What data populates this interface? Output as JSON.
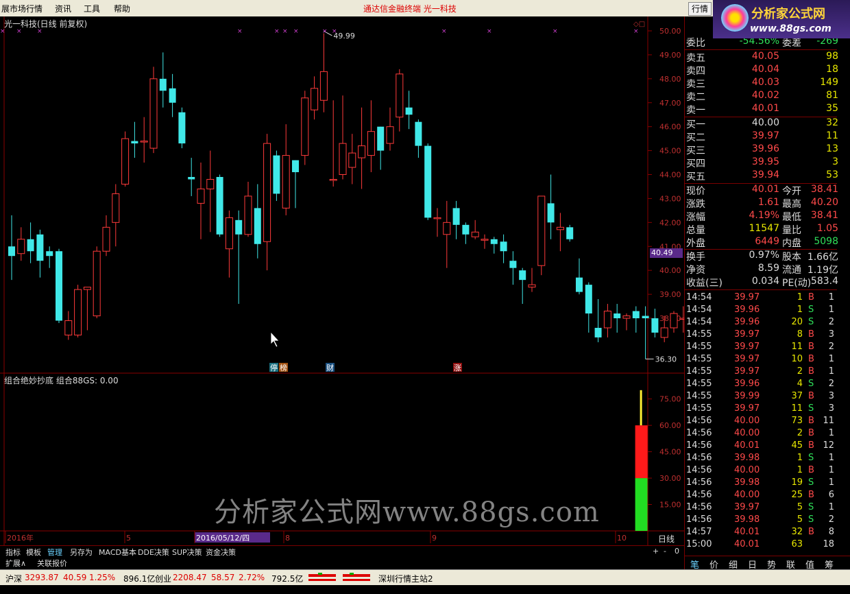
{
  "menu": {
    "items": [
      "展市场行情",
      "资讯",
      "工具",
      "帮助"
    ],
    "center_title": "通达信金融终端   光一科技",
    "trade_button": "行情"
  },
  "logo": {
    "line1": "分析家公式网",
    "line2": "www.88gs.com"
  },
  "chart": {
    "title": "光一科技(日线 前复权)",
    "indicator_title": "组合绝妙抄底  组合88GS: 0.00",
    "watermark": "分析家公式网www.88gs.com",
    "current_price_tag": "40.49",
    "high_label": "49.99",
    "low_label": "36.30",
    "markers": [
      "停",
      "榜",
      "财",
      "涨"
    ],
    "date_labels": [
      "2016年",
      "5",
      "2016/05/12/四",
      "8",
      "9",
      "10"
    ],
    "period": "日线"
  },
  "chart_data": [
    {
      "type": "candlestick",
      "title": "光一科技(日线 前复权)",
      "ylim": [
        36,
        50
      ],
      "yticks": [
        50.0,
        49.0,
        48.0,
        47.0,
        46.0,
        45.0,
        44.0,
        43.0,
        42.0,
        41.0,
        40.0,
        39.0,
        38.0
      ],
      "candles": [
        {
          "o": 41.0,
          "c": 40.6,
          "h": 42.3,
          "l": 39.6
        },
        {
          "o": 40.7,
          "c": 41.3,
          "h": 41.8,
          "l": 40.4
        },
        {
          "o": 41.3,
          "c": 40.8,
          "h": 42.0,
          "l": 40.3
        },
        {
          "o": 41.5,
          "c": 40.4,
          "h": 41.7,
          "l": 39.7
        },
        {
          "o": 40.8,
          "c": 40.6,
          "h": 41.0,
          "l": 40.1
        },
        {
          "o": 40.8,
          "c": 37.9,
          "h": 40.9,
          "l": 37.8
        },
        {
          "o": 37.3,
          "c": 37.9,
          "h": 38.3,
          "l": 37.1
        },
        {
          "o": 37.3,
          "c": 39.2,
          "h": 39.4,
          "l": 37.2
        },
        {
          "o": 39.2,
          "c": 39.3,
          "h": 39.3,
          "l": 37.5
        },
        {
          "o": 38.1,
          "c": 40.8,
          "h": 41.0,
          "l": 38.0
        },
        {
          "o": 40.8,
          "c": 41.8,
          "h": 42.3,
          "l": 40.6
        },
        {
          "o": 42.0,
          "c": 43.2,
          "h": 43.6,
          "l": 41.0
        },
        {
          "o": 43.6,
          "c": 45.5,
          "h": 45.8,
          "l": 43.5
        },
        {
          "o": 45.4,
          "c": 45.3,
          "h": 46.2,
          "l": 44.7
        },
        {
          "o": 45.4,
          "c": 45.4,
          "h": 46.4,
          "l": 44.5
        },
        {
          "o": 45.1,
          "c": 48.0,
          "h": 48.5,
          "l": 44.9
        },
        {
          "o": 48.0,
          "c": 47.5,
          "h": 49.1,
          "l": 46.8
        },
        {
          "o": 47.6,
          "c": 47.0,
          "h": 48.2,
          "l": 46.4
        },
        {
          "o": 46.6,
          "c": 45.3,
          "h": 46.8,
          "l": 45.1
        },
        {
          "o": 43.9,
          "c": 43.8,
          "h": 44.7,
          "l": 43.1
        },
        {
          "o": 42.8,
          "c": 43.4,
          "h": 44.5,
          "l": 41.3
        },
        {
          "o": 43.4,
          "c": 43.8,
          "h": 45.0,
          "l": 41.6
        },
        {
          "o": 43.9,
          "c": 41.5,
          "h": 44.0,
          "l": 41.4
        },
        {
          "o": 40.9,
          "c": 42.2,
          "h": 42.5,
          "l": 39.7
        },
        {
          "o": 42.1,
          "c": 41.5,
          "h": 42.5,
          "l": 38.6
        },
        {
          "o": 41.5,
          "c": 43.1,
          "h": 43.7,
          "l": 41.4
        },
        {
          "o": 42.6,
          "c": 41.1,
          "h": 43.6,
          "l": 40.5
        },
        {
          "o": 41.2,
          "c": 45.3,
          "h": 45.7,
          "l": 40.0
        },
        {
          "o": 44.8,
          "c": 43.2,
          "h": 45.0,
          "l": 42.9
        },
        {
          "o": 42.6,
          "c": 44.8,
          "h": 46.1,
          "l": 42.3
        },
        {
          "o": 44.6,
          "c": 44.1,
          "h": 44.6,
          "l": 42.6
        },
        {
          "o": 44.8,
          "c": 47.2,
          "h": 47.5,
          "l": 44.4
        },
        {
          "o": 46.7,
          "c": 47.6,
          "h": 48.1,
          "l": 46.3
        },
        {
          "o": 47.1,
          "c": 48.3,
          "h": 49.9,
          "l": 46.6
        },
        {
          "o": 43.8,
          "c": 43.8,
          "h": 47.1,
          "l": 43.5
        },
        {
          "o": 44.0,
          "c": 45.3,
          "h": 47.3,
          "l": 43.8
        },
        {
          "o": 44.3,
          "c": 44.9,
          "h": 45.7,
          "l": 43.6
        },
        {
          "o": 44.7,
          "c": 45.2,
          "h": 46.8,
          "l": 43.4
        },
        {
          "o": 44.8,
          "c": 45.8,
          "h": 47.1,
          "l": 44.1
        },
        {
          "o": 46.0,
          "c": 45.0,
          "h": 46.0,
          "l": 44.2
        },
        {
          "o": 45.3,
          "c": 46.0,
          "h": 46.8,
          "l": 45.0
        },
        {
          "o": 46.4,
          "c": 48.2,
          "h": 48.4,
          "l": 45.8
        },
        {
          "o": 46.8,
          "c": 46.5,
          "h": 47.5,
          "l": 45.9
        },
        {
          "o": 46.2,
          "c": 45.2,
          "h": 46.3,
          "l": 44.7
        },
        {
          "o": 45.2,
          "c": 42.2,
          "h": 45.3,
          "l": 42.1
        },
        {
          "o": 42.2,
          "c": 42.2,
          "h": 42.6,
          "l": 41.4
        },
        {
          "o": 41.5,
          "c": 42.0,
          "h": 42.9,
          "l": 40.1
        },
        {
          "o": 42.6,
          "c": 41.9,
          "h": 42.9,
          "l": 41.3
        },
        {
          "o": 41.9,
          "c": 41.5,
          "h": 42.0,
          "l": 41.1
        },
        {
          "o": 41.4,
          "c": 41.6,
          "h": 42.1,
          "l": 41.3
        },
        {
          "o": 41.3,
          "c": 41.3,
          "h": 41.5,
          "l": 40.9
        },
        {
          "o": 41.3,
          "c": 41.1,
          "h": 41.4,
          "l": 40.7
        },
        {
          "o": 41.2,
          "c": 40.8,
          "h": 41.5,
          "l": 40.3
        },
        {
          "o": 40.4,
          "c": 40.1,
          "h": 40.8,
          "l": 39.4
        },
        {
          "o": 40.0,
          "c": 39.6,
          "h": 40.1,
          "l": 38.6
        },
        {
          "o": 39.3,
          "c": 39.4,
          "h": 40.1,
          "l": 39.1
        },
        {
          "o": 40.2,
          "c": 43.1,
          "h": 43.1,
          "l": 39.8
        },
        {
          "o": 42.8,
          "c": 42.0,
          "h": 44.0,
          "l": 41.3
        },
        {
          "o": 41.7,
          "c": 41.8,
          "h": 42.4,
          "l": 40.8
        },
        {
          "o": 41.8,
          "c": 41.3,
          "h": 41.9,
          "l": 41.2
        },
        {
          "o": 39.7,
          "c": 39.1,
          "h": 40.5,
          "l": 39.0
        },
        {
          "o": 39.4,
          "c": 38.2,
          "h": 39.5,
          "l": 37.4
        },
        {
          "o": 37.6,
          "c": 37.2,
          "h": 38.8,
          "l": 37.0
        },
        {
          "o": 37.6,
          "c": 38.3,
          "h": 38.6,
          "l": 37.2
        },
        {
          "o": 38.2,
          "c": 38.0,
          "h": 38.6,
          "l": 37.4
        },
        {
          "o": 38.0,
          "c": 38.1,
          "h": 38.2,
          "l": 37.5
        },
        {
          "o": 38.3,
          "c": 38.0,
          "h": 38.5,
          "l": 37.4
        },
        {
          "o": 38.1,
          "c": 38.0,
          "h": 38.5,
          "l": 36.3
        },
        {
          "o": 38.0,
          "c": 37.4,
          "h": 38.4,
          "l": 37.2
        },
        {
          "o": 37.2,
          "c": 37.6,
          "h": 38.1,
          "l": 37.0
        },
        {
          "o": 37.6,
          "c": 38.2,
          "h": 38.3,
          "l": 37.4
        },
        {
          "o": 38.0,
          "c": 38.0,
          "h": 38.5,
          "l": 37.4
        },
        {
          "o": 38.0,
          "c": 38.5,
          "h": 39.3,
          "l": 37.6
        },
        {
          "o": 38.5,
          "c": 39.9,
          "h": 40.1,
          "l": 38.4
        }
      ]
    },
    {
      "type": "bar",
      "title": "组合绝妙抄底  组合88GS: 0.00",
      "ylim": [
        0,
        85
      ],
      "yticks": [
        75.0,
        60.0,
        45.0,
        30.0,
        15.0
      ],
      "stacked_bar": {
        "position_index": 67,
        "green": [
          0,
          30
        ],
        "red": [
          30,
          60
        ],
        "yellow": [
          60,
          80
        ]
      }
    }
  ],
  "bottom_tabs": [
    "指标",
    "模板",
    "管理",
    "另存为",
    "MACD基本",
    "DDE决策",
    "SUP决策",
    "资金决策"
  ],
  "bottom_tabs_right": [
    "+",
    "-",
    "0"
  ],
  "bottom_tabs2": [
    "扩展∧",
    "关联报价"
  ],
  "quote": {
    "wei_bi": {
      "label": "委比",
      "value": "-54.56%",
      "label2": "委差",
      "value2": "-269"
    },
    "sell": [
      {
        "label": "卖五",
        "price": "40.05",
        "vol": "98"
      },
      {
        "label": "卖四",
        "price": "40.04",
        "vol": "18"
      },
      {
        "label": "卖三",
        "price": "40.03",
        "vol": "149"
      },
      {
        "label": "卖二",
        "price": "40.02",
        "vol": "81"
      },
      {
        "label": "卖一",
        "price": "40.01",
        "vol": "35"
      }
    ],
    "buy": [
      {
        "label": "买一",
        "price": "40.00",
        "vol": "32"
      },
      {
        "label": "买二",
        "price": "39.97",
        "vol": "11"
      },
      {
        "label": "买三",
        "price": "39.96",
        "vol": "13"
      },
      {
        "label": "买四",
        "price": "39.95",
        "vol": "3"
      },
      {
        "label": "买五",
        "price": "39.94",
        "vol": "53"
      }
    ],
    "stats": [
      {
        "l": "现价",
        "v": "40.01",
        "l2": "今开",
        "v2": "38.41"
      },
      {
        "l": "涨跌",
        "v": "1.61",
        "l2": "最高",
        "v2": "40.20"
      },
      {
        "l": "涨幅",
        "v": "4.19%",
        "l2": "最低",
        "v2": "38.41"
      },
      {
        "l": "总量",
        "v": "11547",
        "l2": "量比",
        "v2": "1.05"
      },
      {
        "l": "外盘",
        "v": "6449",
        "l2": "内盘",
        "v2": "5098"
      }
    ],
    "stats2": [
      {
        "l": "换手",
        "v": "0.97%",
        "l2": "股本",
        "v2": "1.66亿"
      },
      {
        "l": "净资",
        "v": "8.59",
        "l2": "流通",
        "v2": "1.19亿"
      },
      {
        "l": "收益(三)",
        "v": "0.034",
        "l2": "PE(动)",
        "v2": "583.4"
      }
    ]
  },
  "ticks": [
    {
      "t": "14:54",
      "p": "39.97",
      "v": "1",
      "d": "B",
      "n": "1"
    },
    {
      "t": "14:54",
      "p": "39.96",
      "v": "1",
      "d": "S",
      "n": "1"
    },
    {
      "t": "14:54",
      "p": "39.96",
      "v": "20",
      "d": "S",
      "n": "2"
    },
    {
      "t": "14:55",
      "p": "39.97",
      "v": "8",
      "d": "B",
      "n": "3"
    },
    {
      "t": "14:55",
      "p": "39.97",
      "v": "11",
      "d": "B",
      "n": "2"
    },
    {
      "t": "14:55",
      "p": "39.97",
      "v": "10",
      "d": "B",
      "n": "1"
    },
    {
      "t": "14:55",
      "p": "39.97",
      "v": "2",
      "d": "B",
      "n": "1"
    },
    {
      "t": "14:55",
      "p": "39.96",
      "v": "4",
      "d": "S",
      "n": "2"
    },
    {
      "t": "14:55",
      "p": "39.99",
      "v": "37",
      "d": "B",
      "n": "3"
    },
    {
      "t": "14:55",
      "p": "39.97",
      "v": "11",
      "d": "S",
      "n": "3"
    },
    {
      "t": "14:56",
      "p": "40.00",
      "v": "73",
      "d": "B",
      "n": "11"
    },
    {
      "t": "14:56",
      "p": "40.00",
      "v": "2",
      "d": "B",
      "n": "1"
    },
    {
      "t": "14:56",
      "p": "40.01",
      "v": "45",
      "d": "B",
      "n": "12"
    },
    {
      "t": "14:56",
      "p": "39.98",
      "v": "1",
      "d": "S",
      "n": "1"
    },
    {
      "t": "14:56",
      "p": "40.00",
      "v": "1",
      "d": "B",
      "n": "1"
    },
    {
      "t": "14:56",
      "p": "39.98",
      "v": "19",
      "d": "S",
      "n": "1"
    },
    {
      "t": "14:56",
      "p": "40.00",
      "v": "25",
      "d": "B",
      "n": "6"
    },
    {
      "t": "14:56",
      "p": "39.97",
      "v": "5",
      "d": "S",
      "n": "1"
    },
    {
      "t": "14:56",
      "p": "39.98",
      "v": "5",
      "d": "S",
      "n": "2"
    },
    {
      "t": "14:57",
      "p": "40.01",
      "v": "32",
      "d": "B",
      "n": "8"
    },
    {
      "t": "15:00",
      "p": "40.01",
      "v": "63",
      "d": "",
      "n": "18"
    }
  ],
  "right_tabs": [
    "笔",
    "价",
    "细",
    "日",
    "势",
    "联",
    "值",
    "筹"
  ],
  "status": {
    "hs_label": "沪深",
    "hs_value": "3293.87",
    "hs_chg": "40.59",
    "hs_pct": "1.25%",
    "hs_amt": "896.1亿",
    "cy_label": "创业",
    "cy_value": "2208.47",
    "cy_chg": "58.57",
    "cy_pct": "2.72%",
    "cy_amt": "792.5亿",
    "server": "深圳行情主站2"
  }
}
